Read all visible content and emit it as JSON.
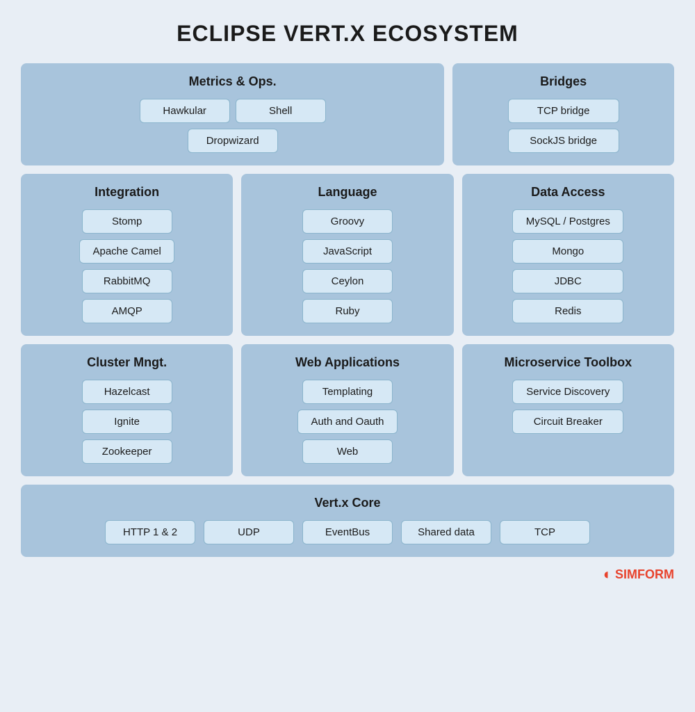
{
  "page": {
    "title": "ECLIPSE VERT.X ECOSYSTEM"
  },
  "sections": {
    "metrics": {
      "title": "Metrics & Ops.",
      "items": [
        "Hawkular",
        "Dropwizard",
        "Shell"
      ]
    },
    "bridges": {
      "title": "Bridges",
      "items": [
        "TCP bridge",
        "SockJS bridge"
      ]
    },
    "integration": {
      "title": "Integration",
      "items": [
        "Stomp",
        "Apache Camel",
        "RabbitMQ",
        "AMQP"
      ]
    },
    "language": {
      "title": "Language",
      "items": [
        "Groovy",
        "JavaScript",
        "Ceylon",
        "Ruby"
      ]
    },
    "dataaccess": {
      "title": "Data Access",
      "items": [
        "MySQL / Postgres",
        "Mongo",
        "JDBC",
        "Redis"
      ]
    },
    "cluster": {
      "title": "Cluster Mngt.",
      "items": [
        "Hazelcast",
        "Ignite",
        "Zookeeper"
      ]
    },
    "webapp": {
      "title": "Web Applications",
      "items": [
        "Templating",
        "Auth and Oauth",
        "Web"
      ]
    },
    "microservice": {
      "title": "Microservice Toolbox",
      "items": [
        "Service Discovery",
        "Circuit Breaker"
      ]
    },
    "core": {
      "title": "Vert.x Core",
      "items": [
        "HTTP 1 & 2",
        "UDP",
        "EventBus",
        "Shared data",
        "TCP"
      ]
    }
  },
  "footer": {
    "logo_s": "S",
    "logo_text": "SIMFORM"
  }
}
